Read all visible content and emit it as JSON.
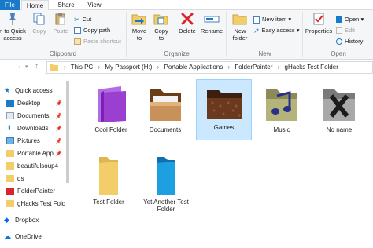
{
  "tabs": {
    "file": "File",
    "home": "Home",
    "share": "Share",
    "view": "View"
  },
  "ribbon": {
    "clipboard": {
      "pin_to_quick_access": "n to Quick\naccess",
      "copy": "Copy",
      "paste": "Paste",
      "cut": "Cut",
      "copy_path": "Copy path",
      "paste_shortcut": "Paste shortcut",
      "label": "Clipboard"
    },
    "organize": {
      "move_to": "Move\nto",
      "copy_to": "Copy\nto",
      "delete": "Delete",
      "rename": "Rename",
      "label": "Organize"
    },
    "new": {
      "new_folder": "New\nfolder",
      "new_item": "New item",
      "easy_access": "Easy access",
      "label": "New"
    },
    "open": {
      "properties": "Properties",
      "open": "Open",
      "edit": "Edit",
      "history": "History",
      "label": "Open"
    }
  },
  "address": {
    "crumbs": [
      "This PC",
      "My Passport (H:)",
      "Portable Applications",
      "FolderPainter",
      "gHacks Test Folder"
    ]
  },
  "nav": {
    "items": [
      {
        "label": "Quick access",
        "icon": "star-icon",
        "pinned": false
      },
      {
        "label": "Desktop",
        "icon": "desktop-icon",
        "pinned": true
      },
      {
        "label": "Documents",
        "icon": "documents-icon",
        "pinned": true
      },
      {
        "label": "Downloads",
        "icon": "downloads-icon",
        "pinned": true
      },
      {
        "label": "Pictures",
        "icon": "pictures-icon",
        "pinned": true
      },
      {
        "label": "Portable App",
        "icon": "folder-icon",
        "pinned": true
      },
      {
        "label": "beautifulsoup4",
        "icon": "folder-icon",
        "pinned": false
      },
      {
        "label": "ds",
        "icon": "folder-icon",
        "pinned": false
      },
      {
        "label": "FolderPainter",
        "icon": "app-icon",
        "pinned": false
      },
      {
        "label": "gHacks Test Fold",
        "icon": "folder-icon",
        "pinned": false
      },
      {
        "label": "Dropbox",
        "icon": "dropbox-icon",
        "pinned": false
      },
      {
        "label": "OneDrive",
        "icon": "onedrive-icon",
        "pinned": false
      }
    ]
  },
  "files": [
    {
      "name": "Cool Folder",
      "color": "#9b3fd1"
    },
    {
      "name": "Documents",
      "color": "#8a5a2b"
    },
    {
      "name": "Games",
      "color": "#6b3a1e"
    },
    {
      "name": "Music",
      "color": "#6d6d3a"
    },
    {
      "name": "No name",
      "color": "#555555"
    },
    {
      "name": "Test Folder",
      "color": "#f3cd6a"
    },
    {
      "name": "Yet Another Test Folder",
      "color": "#1e9fe0"
    }
  ],
  "colors": {
    "accent": "#1979ca",
    "selection": "#cce8ff",
    "folder_yellow": "#f3cd6a"
  }
}
